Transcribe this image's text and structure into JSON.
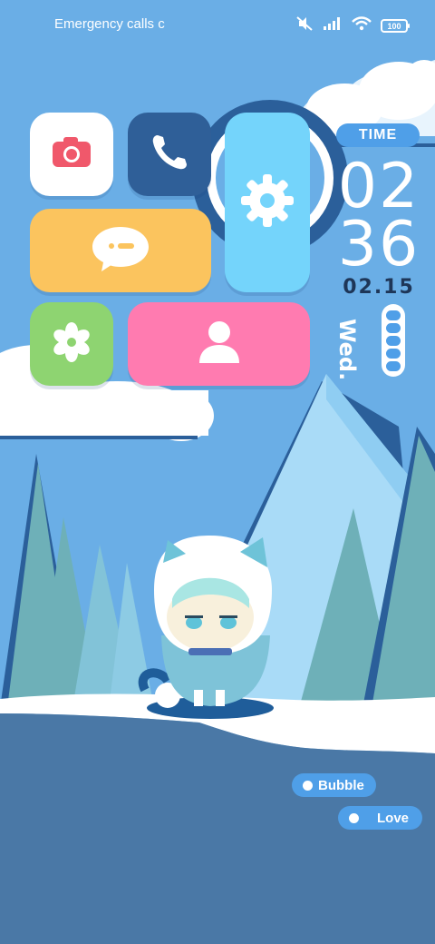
{
  "status_bar": {
    "left_text": "Emergency calls c",
    "battery_level": "100",
    "icons": [
      "mute-icon",
      "signal-icon",
      "wifi-icon",
      "battery-icon"
    ]
  },
  "apps": [
    {
      "name": "Camera",
      "icon": "camera-icon",
      "color": "#ffffff"
    },
    {
      "name": "Phone",
      "icon": "phone-icon",
      "color": "#2f5f98"
    },
    {
      "name": "Settings",
      "icon": "gear-icon",
      "color": "#74d4fb"
    },
    {
      "name": "Messages",
      "icon": "message-icon",
      "color": "#fbc45e"
    },
    {
      "name": "Gallery",
      "icon": "flower-icon",
      "color": "#8ed471"
    },
    {
      "name": "Contacts",
      "icon": "person-icon",
      "color": "#ff7bb0"
    }
  ],
  "clock": {
    "label": "TIME",
    "hours": "02",
    "minutes": "36",
    "date": "02.15",
    "day": "Wed.",
    "battery_segments": 5
  },
  "chips": {
    "bubble": "Bubble",
    "love": "Love"
  },
  "colors": {
    "sky": "#6aaee6",
    "accent": "#4f9fe8",
    "ground": "#4a78a6"
  }
}
